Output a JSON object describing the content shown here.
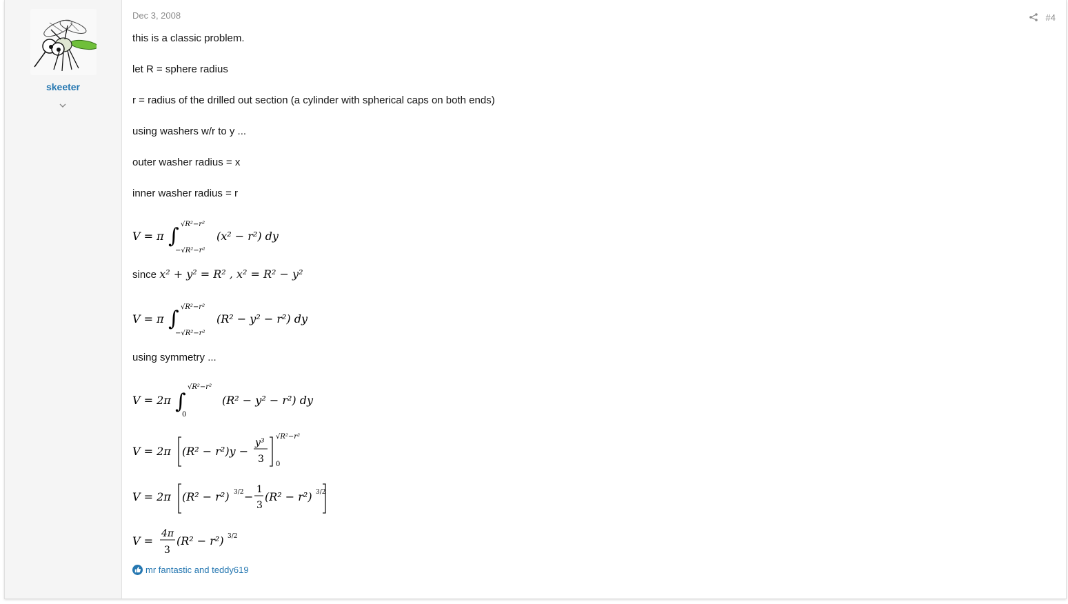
{
  "user": {
    "name": "skeeter",
    "avatar_icon": "mosquito-avatar-icon"
  },
  "post": {
    "date": "Dec 3, 2008",
    "number": "#4",
    "lines": [
      "this is a classic problem.",
      "let R = sphere radius",
      "r = radius of the drilled out section (a cylinder with spherical caps on both ends)",
      "using washers w/r to y ...",
      "outer washer radius = x",
      "inner washer radius = r"
    ],
    "since_label": "since",
    "symmetry_label": "using symmetry ...",
    "equations": {
      "eq1": "V = π ∫_{−√(R²−r²)}^{√(R²−r²)} (x² − r²) dy",
      "since": "x² + y² = R² , x² = R² − y²",
      "eq2": "V = π ∫_{−√(R²−r²)}^{√(R²−r²)} (R² − y² − r²) dy",
      "eq3": "V = 2π ∫_0^{√(R²−r²)} (R² − y² − r²) dy",
      "eq4": "V = 2π [(R² − r²)y − y³/3]_0^{√(R²−r²)}",
      "eq5": "V = 2π [(R² − r²)^{3/2} − (1/3)(R² − r²)^{3/2}]",
      "eq6": "V = (4π/3)(R² − r²)^{3/2}"
    }
  },
  "reactions": {
    "text": "mr fantastic and teddy619",
    "icon": "like-icon"
  }
}
